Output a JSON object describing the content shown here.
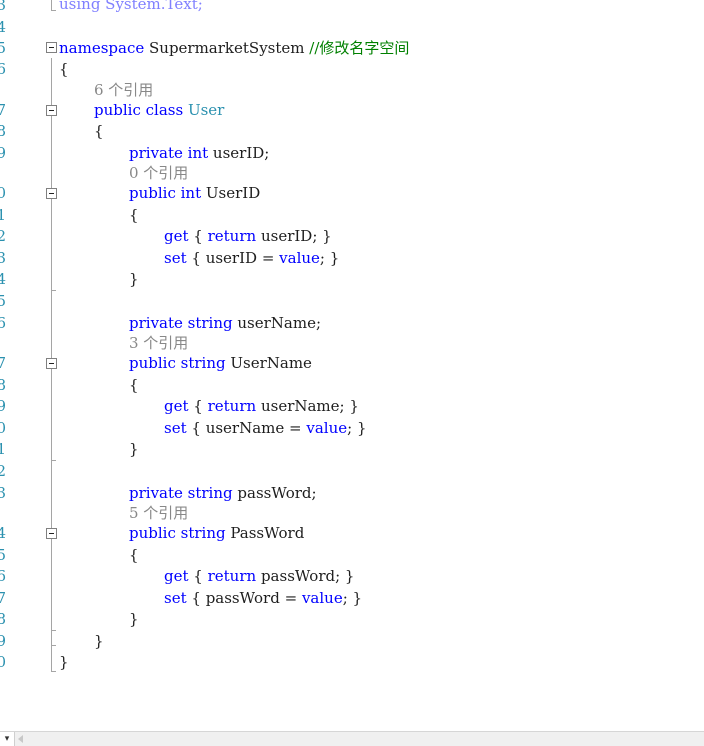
{
  "editor": {
    "line_numbers": [
      "3",
      "4",
      "5",
      "6",
      "7",
      "8",
      "9",
      "0",
      "1",
      "2",
      "3",
      "4",
      "5",
      "6",
      "7",
      "8",
      "9",
      "0",
      "1",
      "2",
      "3",
      "4",
      "5",
      "6",
      "7",
      "8",
      "9",
      "0"
    ],
    "lines": {
      "using_line": "using System.Text;",
      "ns_kw": "namespace",
      "ns_name": " SupermarketSystem ",
      "ns_comment": "//修改名字空间",
      "open_ns": "{",
      "lens_user": "6 个引用",
      "class_kw": "public class",
      "class_name": "User",
      "open_class": "{",
      "f1_kw": "private int",
      "f1_name": " userID;",
      "lens_userid": "0 个引用",
      "p1_kw": "public int",
      "p1_name": " UserID",
      "p1_open": "{",
      "p1_get_kw": "get",
      "p1_get_mid": " { ",
      "p1_get_ret": "return",
      "p1_get_end": " userID; }",
      "p1_set_kw": "set",
      "p1_set_mid": " { userID = ",
      "p1_set_val": "value",
      "p1_set_end": "; }",
      "p1_close": "}",
      "f2_kw": "private string",
      "f2_name": " userName;",
      "lens_username": "3 个引用",
      "p2_kw": "public string",
      "p2_name": " UserName",
      "p2_open": "{",
      "p2_get_kw": "get",
      "p2_get_mid": " { ",
      "p2_get_ret": "return",
      "p2_get_end": " userName; }",
      "p2_set_kw": "set",
      "p2_set_mid": " { userName = ",
      "p2_set_val": "value",
      "p2_set_end": "; }",
      "p2_close": "}",
      "f3_kw": "private string",
      "f3_name": " passWord;",
      "lens_password": "5 个引用",
      "p3_kw": "public string",
      "p3_name": " PassWord",
      "p3_open": "{",
      "p3_get_kw": "get",
      "p3_get_mid": " { ",
      "p3_get_ret": "return",
      "p3_get_end": " passWord; }",
      "p3_set_kw": "set",
      "p3_set_mid": " { passWord = ",
      "p3_set_val": "value",
      "p3_set_end": "; }",
      "p3_close": "}",
      "close_class": "}",
      "close_ns": "}"
    }
  },
  "icons": {
    "fold": "collapse-minus-icon",
    "zoom_dropdown": "chevron-down-icon",
    "scroll_left": "arrow-left-icon"
  },
  "colors": {
    "keyword": "#0000ff",
    "type": "#2b91af",
    "comment": "#008000",
    "codelens": "#888888",
    "line_number": "#2b91af"
  }
}
